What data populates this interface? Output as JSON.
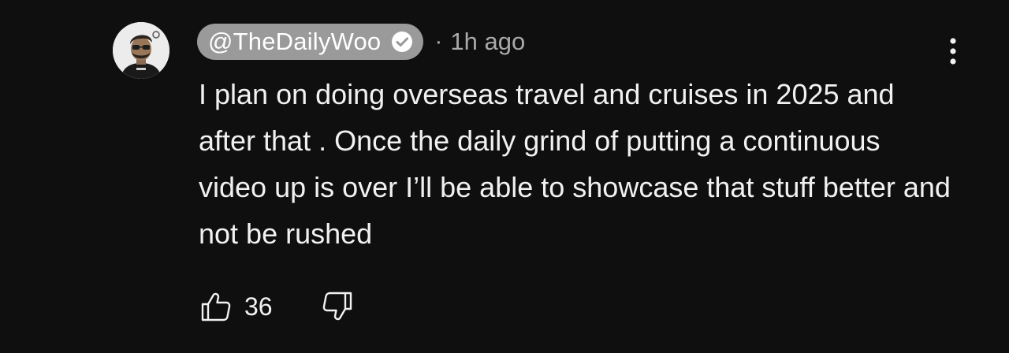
{
  "comment": {
    "author": "@TheDailyWoo",
    "verified": true,
    "separator": "·",
    "time": "1h ago",
    "text": "I plan on doing overseas travel and cruises in 2025 and after that . Once the daily grind of putting a continuous video up is over I’ll be able to showcase that stuff better and not be rushed",
    "like_count": "36"
  },
  "icons": {
    "avatar": "avatar-image",
    "verified": "verified-check-icon",
    "more": "more-vertical-icon",
    "like": "thumbs-up-icon",
    "dislike": "thumbs-down-icon"
  },
  "colors": {
    "background": "#0f0f0f",
    "text": "#f1f1f1",
    "secondary_text": "#aaaaaa",
    "author_chip": "#9a9a9a"
  }
}
